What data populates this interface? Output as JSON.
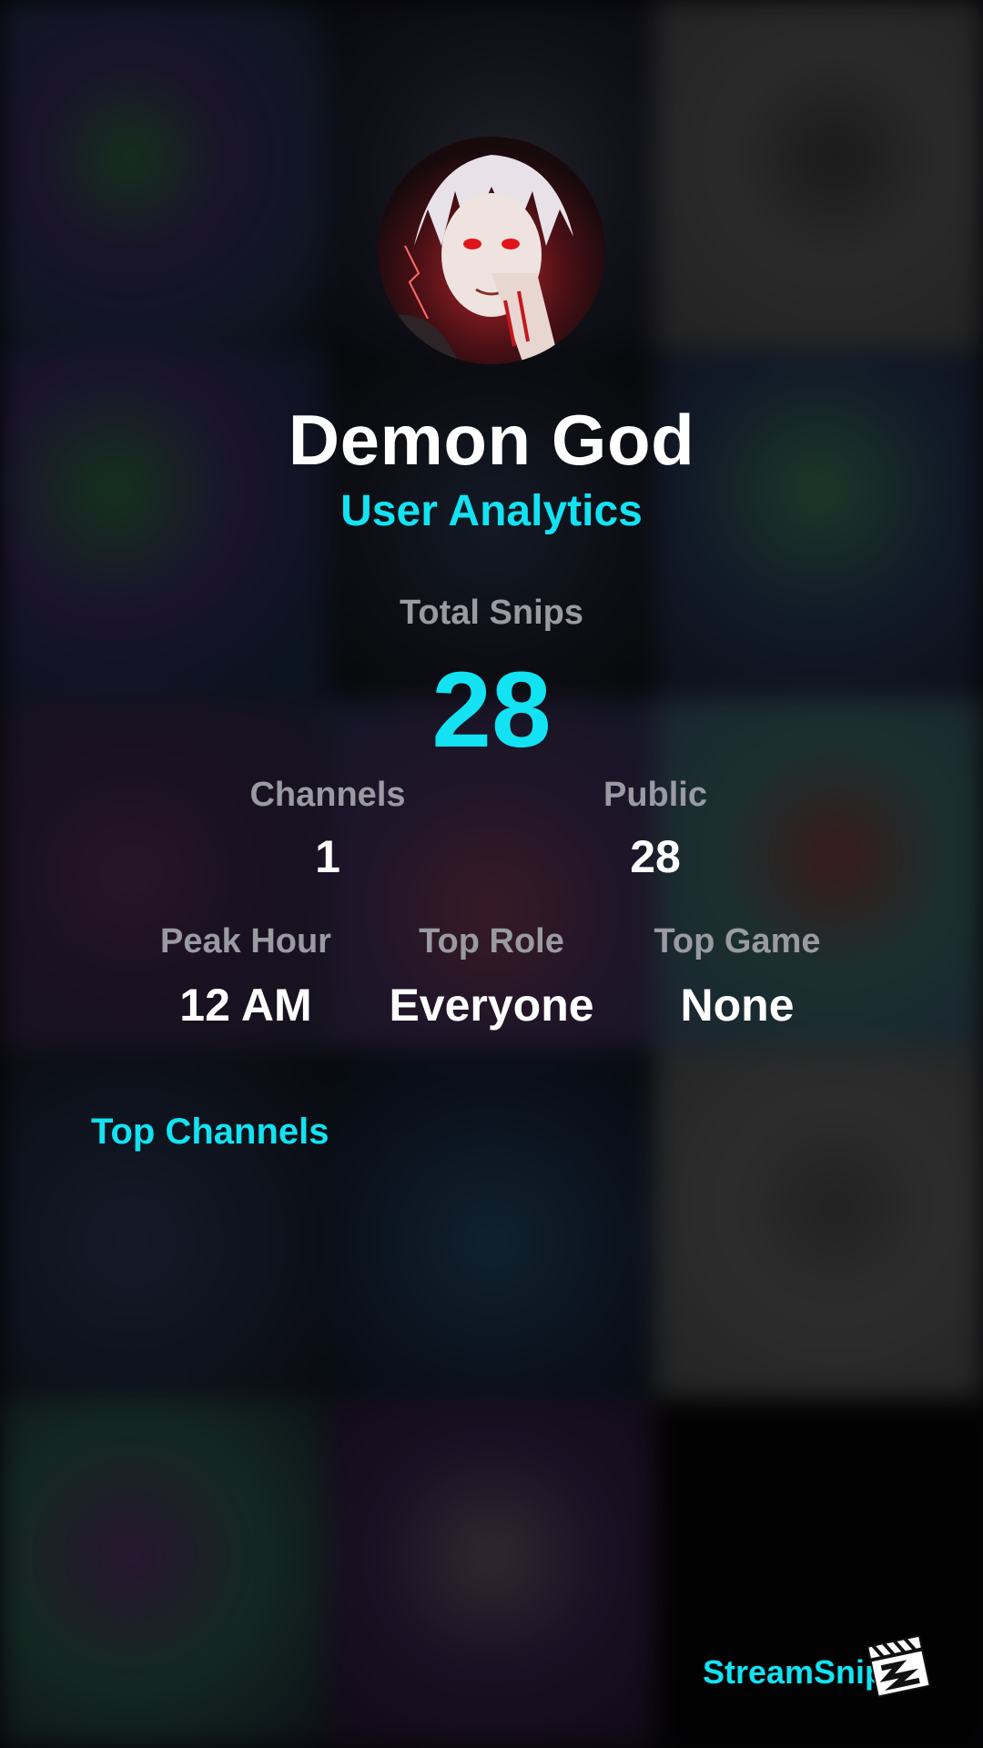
{
  "profile": {
    "username": "Demon God",
    "subtitle": "User Analytics"
  },
  "stats": {
    "total_snips_label": "Total Snips",
    "total_snips_value": "28",
    "channels_label": "Channels",
    "channels_value": "1",
    "public_label": "Public",
    "public_value": "28",
    "peak_hour_label": "Peak Hour",
    "peak_hour_value": "12 AM",
    "top_role_label": "Top Role",
    "top_role_value": "Everyone",
    "top_game_label": "Top Game",
    "top_game_value": "None"
  },
  "sections": {
    "top_channels_title": "Top Channels"
  },
  "branding": {
    "name": "StreamSnip",
    "logo_icon": "clapperboard-icon"
  },
  "colors": {
    "accent": "#13e2f2",
    "label": "#9a9aa3",
    "value": "#ffffff"
  }
}
